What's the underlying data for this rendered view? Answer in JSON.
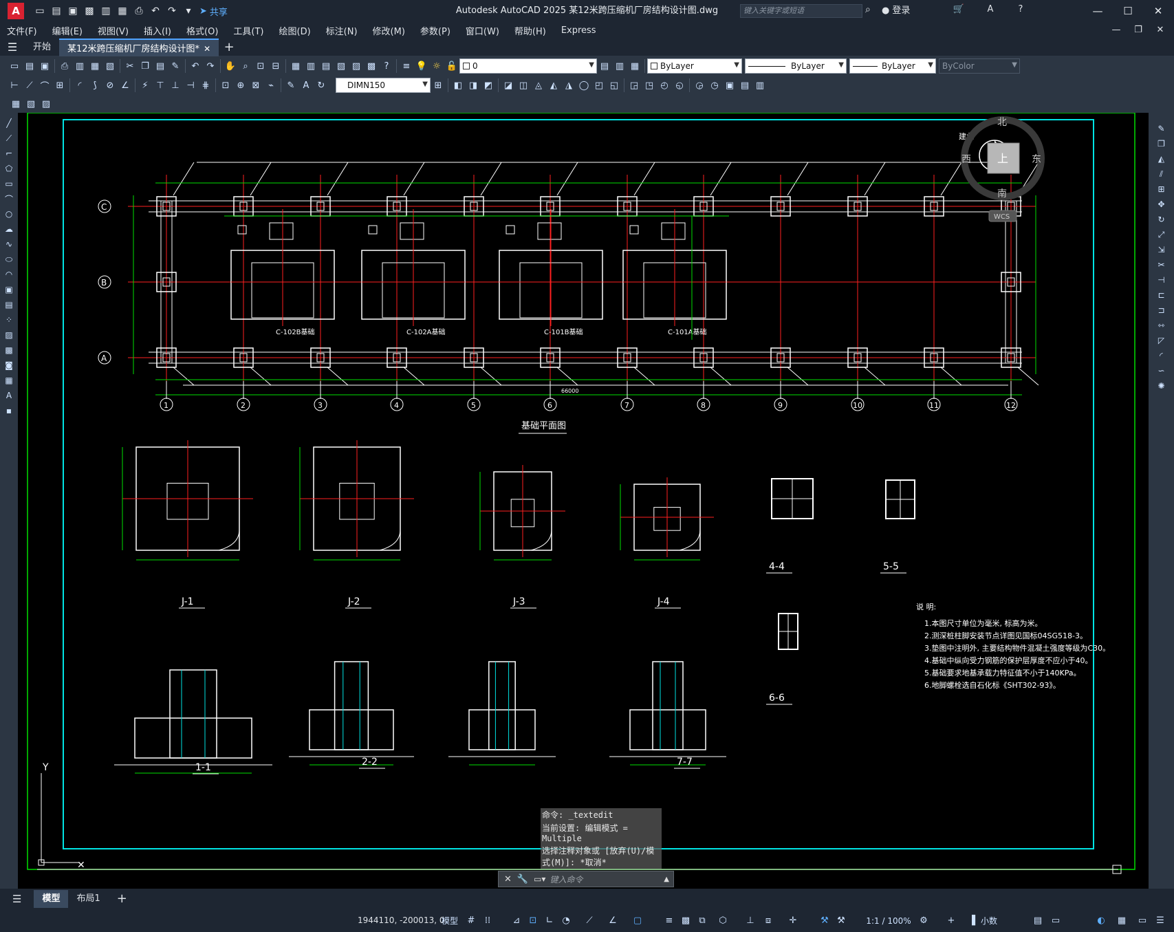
{
  "app": {
    "logo_letter": "A",
    "title": "Autodesk AutoCAD 2025    某12米跨压缩机厂房结构设计图.dwg",
    "share_label": "共享",
    "search_placeholder": "键入关键字或短语",
    "login_label": "登录"
  },
  "menu": [
    "文件(F)",
    "编辑(E)",
    "视图(V)",
    "插入(I)",
    "格式(O)",
    "工具(T)",
    "绘图(D)",
    "标注(N)",
    "修改(M)",
    "参数(P)",
    "窗口(W)",
    "帮助(H)",
    "Express"
  ],
  "tabs": {
    "start": "开始",
    "active": "某12米跨压缩机厂房结构设计图*"
  },
  "toolbar": {
    "layer_value": "0",
    "color_value": "ByLayer",
    "linetype_value": "ByLayer",
    "lineweight_value": "ByLayer",
    "plotstyle_value": "ByColor",
    "dimstyle_value": "DIMN150"
  },
  "viewcube": {
    "north": "北",
    "south": "南",
    "east": "东",
    "west": "西",
    "top": "上",
    "wcs": "WCS",
    "building_north": "建北"
  },
  "drawing": {
    "plan_title": "基础平面图",
    "grid_rows": [
      "C",
      "B",
      "A"
    ],
    "grid_cols": [
      "1",
      "2",
      "3",
      "4",
      "5",
      "6",
      "7",
      "8",
      "9",
      "10",
      "11",
      "12"
    ],
    "equip_labels": [
      "C-102B基础",
      "C-102A基础",
      "C-101B基础",
      "C-101A基础"
    ],
    "detail_titles": [
      "J-1",
      "J-2",
      "J-3",
      "J-4",
      "4-4",
      "5-5",
      "6-6"
    ],
    "section_titles": [
      "1-1",
      "2-2",
      "7-7"
    ],
    "total_dim": "66000",
    "notes_title": "说 明:",
    "notes": [
      "1.本图尺寸单位为毫米, 标高为米。",
      "2.测深桩柱脚安装节点详图见国标04SG518-3。",
      "3.垫图中注明外, 主要结构物件混凝土强度等级为C30。",
      "4.基础中纵向受力钢筋的保护层厚度不应小于40。",
      "5.基础要求地基承载力特征值不小于140KPa。",
      "6.地脚螺栓选自石化标《SHT302-93》。"
    ]
  },
  "command": {
    "history": [
      "命令: _textedit",
      "当前设置: 编辑模式 = Multiple",
      "选择注释对象或 [放弃(U)/模式(M)]: *取消*"
    ],
    "input_placeholder": "键入命令"
  },
  "layout_tabs": [
    "模型",
    "布局1"
  ],
  "status": {
    "coords": "1944110, -200013, 0",
    "model_label": "模型",
    "scale": "1:1 / 100%",
    "units": "小数"
  }
}
